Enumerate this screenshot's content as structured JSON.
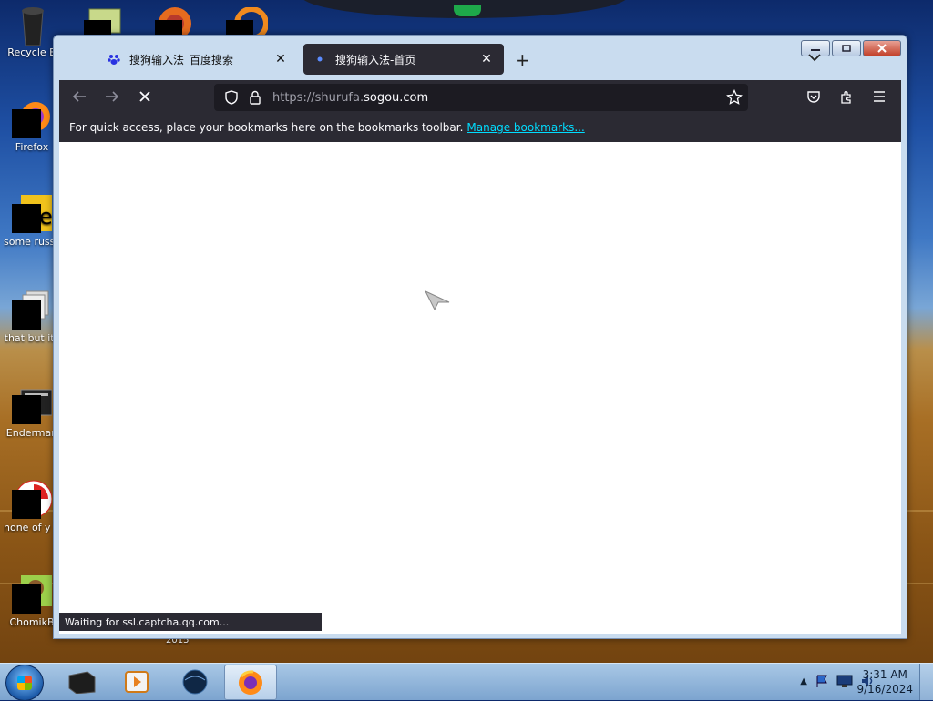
{
  "desktop": {
    "icons": [
      {
        "label": "Recycle B",
        "icon": "recycle-bin-icon"
      },
      {
        "label": "Firefox",
        "icon": "firefox-icon"
      },
      {
        "label": "some russ ran a ra",
        "icon": "document-icon"
      },
      {
        "label": "that but its",
        "icon": "folder-icon"
      },
      {
        "label": "Enderman",
        "icon": "app-icon"
      },
      {
        "label": "none of y retards kn",
        "icon": "app-icon"
      },
      {
        "label": "ChomikB",
        "icon": "app-icon"
      }
    ],
    "partial_label": "2015"
  },
  "browser": {
    "tabs": [
      {
        "title": "搜狗输入法_百度搜索",
        "icon": "baidu-paw-icon",
        "active": false
      },
      {
        "title": "搜狗输入法-首页",
        "icon": "dot-icon",
        "active": true
      }
    ],
    "url_prefix": "https://shurufa.",
    "url_domain": "sogou.com",
    "bookmarks_message": "For quick access, place your bookmarks here on the bookmarks toolbar.",
    "bookmarks_link": "Manage bookmarks...",
    "status_text": "Waiting for ssl.captcha.qq.com..."
  },
  "taskbar": {
    "time": "3:31 AM",
    "date": "9/16/2024"
  },
  "colors": {
    "browser_dark": "#2b2a33",
    "url_field": "#1c1b22",
    "link": "#00ddff"
  }
}
